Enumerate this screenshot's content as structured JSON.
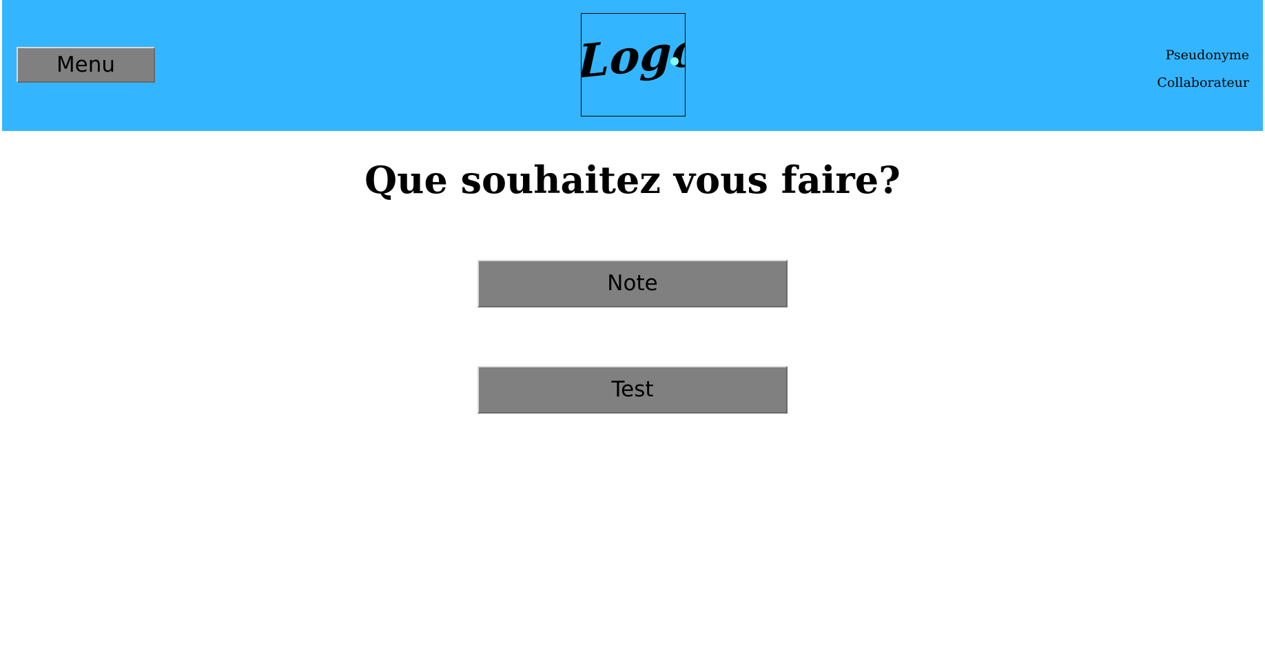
{
  "colors": {
    "header_bg": "#33b6ff",
    "button_bg": "#808080",
    "logo_dot": "#7fffff"
  },
  "header": {
    "menu_label": "Menu",
    "logo_text": "Logo",
    "user": {
      "pseudonym": "Pseudonyme",
      "role": "Collaborateur"
    }
  },
  "main": {
    "title": "Que souhaitez vous faire?",
    "actions": [
      {
        "label": "Note"
      },
      {
        "label": "Test"
      }
    ]
  }
}
